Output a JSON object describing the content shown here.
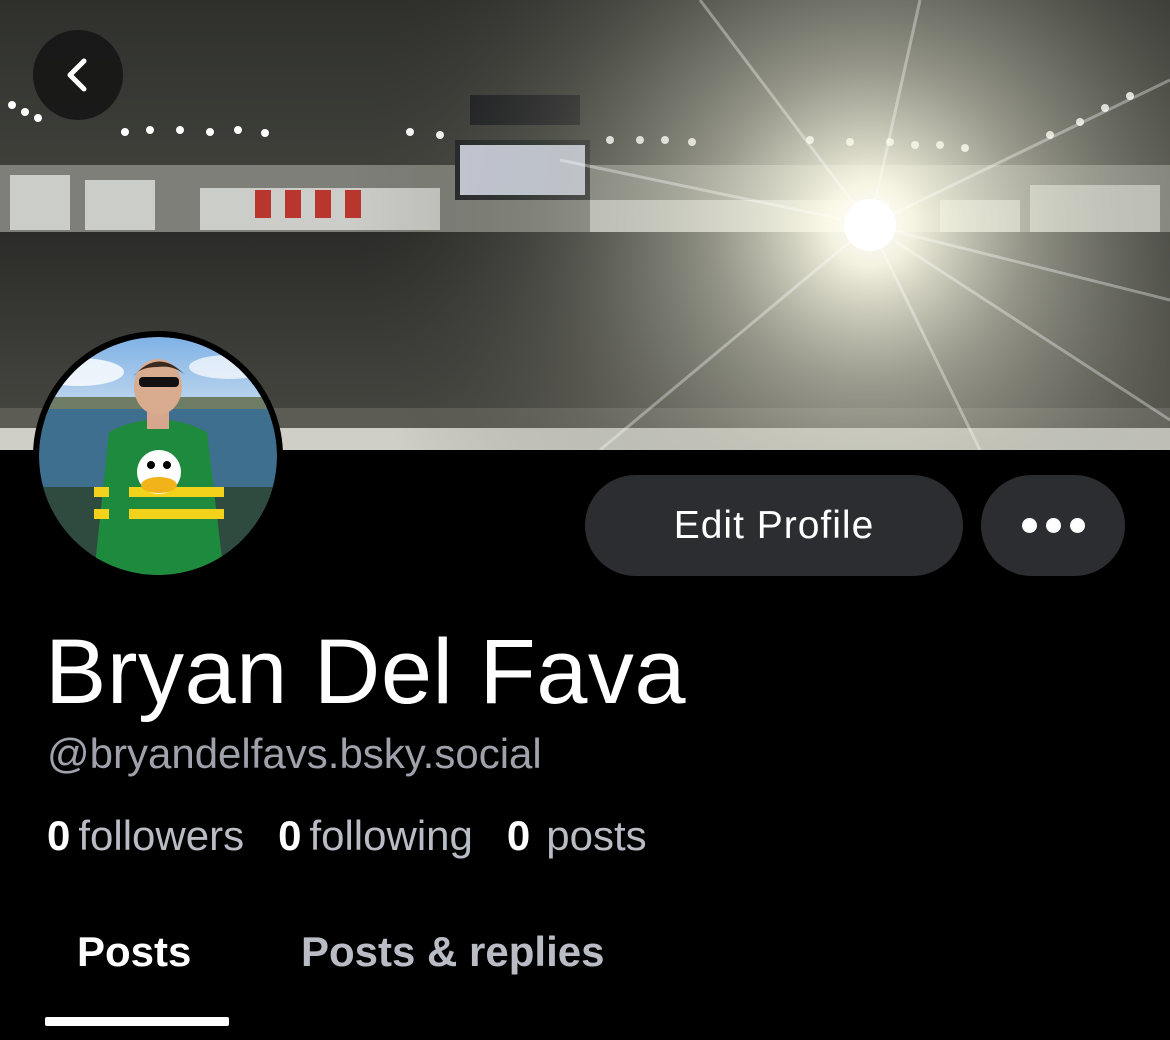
{
  "profile": {
    "display_name": "Bryan Del Fava",
    "handle": "@bryandelfavs.bsky.social"
  },
  "actions": {
    "edit_label": "Edit Profile",
    "more_icon": "ellipsis-icon",
    "back_icon": "chevron-left-icon"
  },
  "stats": {
    "followers_count": "0",
    "followers_label": "followers",
    "following_count": "0",
    "following_label": "following",
    "posts_count": "0",
    "posts_label": "posts"
  },
  "tabs": [
    {
      "label": "Posts",
      "active": true
    },
    {
      "label": "Posts & replies",
      "active": false
    }
  ],
  "colors": {
    "background": "#000000",
    "button_bg": "#2c2d31",
    "secondary_text": "#9fa2ab"
  }
}
